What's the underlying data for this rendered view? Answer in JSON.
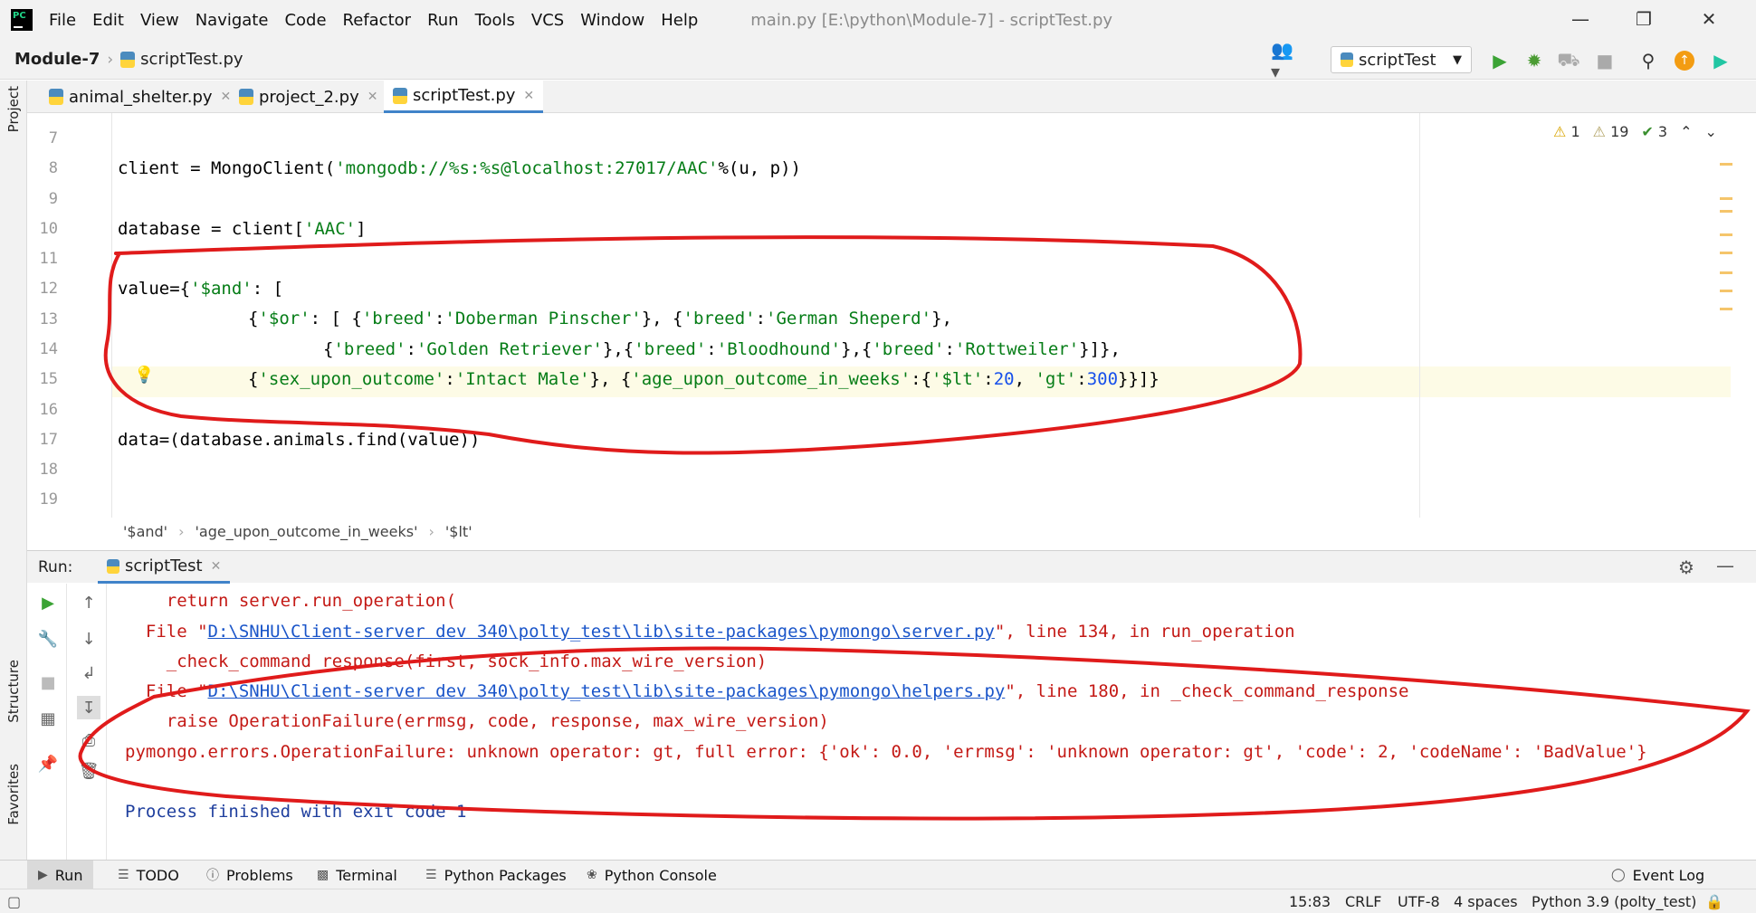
{
  "menubar": {
    "items": [
      "File",
      "Edit",
      "View",
      "Navigate",
      "Code",
      "Refactor",
      "Run",
      "Tools",
      "VCS",
      "Window",
      "Help"
    ],
    "window_title": "main.py [E:\\python\\Module-7] - scriptTest.py"
  },
  "navbar": {
    "project": "Module-7",
    "file": "scriptTest.py",
    "run_config": "scriptTest"
  },
  "side_panels": {
    "project": "Project",
    "structure": "Structure",
    "favorites": "Favorites"
  },
  "tabs": [
    {
      "label": "animal_shelter.py"
    },
    {
      "label": "project_2.py"
    },
    {
      "label": "scriptTest.py"
    }
  ],
  "inspections": {
    "errors": "1",
    "warnings": "19",
    "ok": "3"
  },
  "editor": {
    "line_numbers": [
      "7",
      "8",
      "9",
      "10",
      "11",
      "12",
      "13",
      "14",
      "15",
      "16",
      "17",
      "18",
      "19"
    ],
    "line8": {
      "a": "client = MongoClient(",
      "b": "'mongodb://%s:%s@localhost:27017/AAC'",
      "c": "%(u, p))"
    },
    "line10": {
      "a": "database = client[",
      "b": "'AAC'",
      "c": "]"
    },
    "line12": {
      "a": "value={",
      "b": "'$and'",
      "c": ": ["
    },
    "line13": {
      "a": "{",
      "b": "'$or'",
      "c": ": [ {",
      "d": "'breed'",
      "e": ":",
      "f": "'Doberman Pinscher'",
      "g": "}, {",
      "h": "'breed'",
      "i": ":",
      "j": "'German Sheperd'",
      "k": "},"
    },
    "line14": {
      "a": "{",
      "b": "'breed'",
      "c": ":",
      "d": "'Golden Retriever'",
      "e": "},{",
      "f": "'breed'",
      "g": ":",
      "h": "'Bloodhound'",
      "i": "},{",
      "j": "'breed'",
      "k": ":",
      "l": "'Rottweiler'",
      "m": "}]},"
    },
    "line15": {
      "a": "{",
      "b": "'sex_upon_outcome'",
      "c": ":",
      "d": "'Intact Male'",
      "e": "}, {",
      "f": "'age_upon_outcome_in_weeks'",
      "g": ":{",
      "h": "'$lt'",
      "i": ":",
      "j": "20",
      "k": ", ",
      "l": "'gt'",
      "m": ":",
      "n": "300",
      "o": "}}]}"
    },
    "line17": {
      "a": "data=(database.animals.find(value))"
    }
  },
  "breadcrumbs": [
    "'$and'",
    "'age_upon_outcome_in_weeks'",
    "'$lt'"
  ],
  "run_panel": {
    "title": "Run:",
    "tab": "scriptTest"
  },
  "console": {
    "l1": "    return server.run_operation(",
    "l2_a": "  File \"",
    "l2_link": "D:\\SNHU\\Client-server dev 340\\polty_test\\lib\\site-packages\\pymongo\\server.py",
    "l2_b": "\", line 134, in run_operation",
    "l3": "    _check_command_response(first, sock_info.max_wire_version)",
    "l4_a": "  File \"",
    "l4_link": "D:\\SNHU\\Client-server dev 340\\polty_test\\lib\\site-packages\\pymongo\\helpers.py",
    "l4_b": "\", line 180, in _check_command_response",
    "l5": "    raise OperationFailure(errmsg, code, response, max_wire_version)",
    "l6": "pymongo.errors.OperationFailure: unknown operator: gt, full error: {'ok': 0.0, 'errmsg': 'unknown operator: gt', 'code': 2, 'codeName': 'BadValue'}",
    "l8": "Process finished with exit code 1"
  },
  "bottom_tools": [
    "Run",
    "TODO",
    "Problems",
    "Terminal",
    "Python Packages",
    "Python Console",
    "Event Log"
  ],
  "status": {
    "position": "15:83",
    "line_sep": "CRLF",
    "encoding": "UTF-8",
    "indent": "4 spaces",
    "interpreter": "Python 3.9 (polty_test)"
  },
  "colors": {
    "annotation": "#e01b1b",
    "string": "#067d17",
    "number": "#1750eb",
    "error_text": "#c41a16",
    "link": "#1a55c9"
  }
}
